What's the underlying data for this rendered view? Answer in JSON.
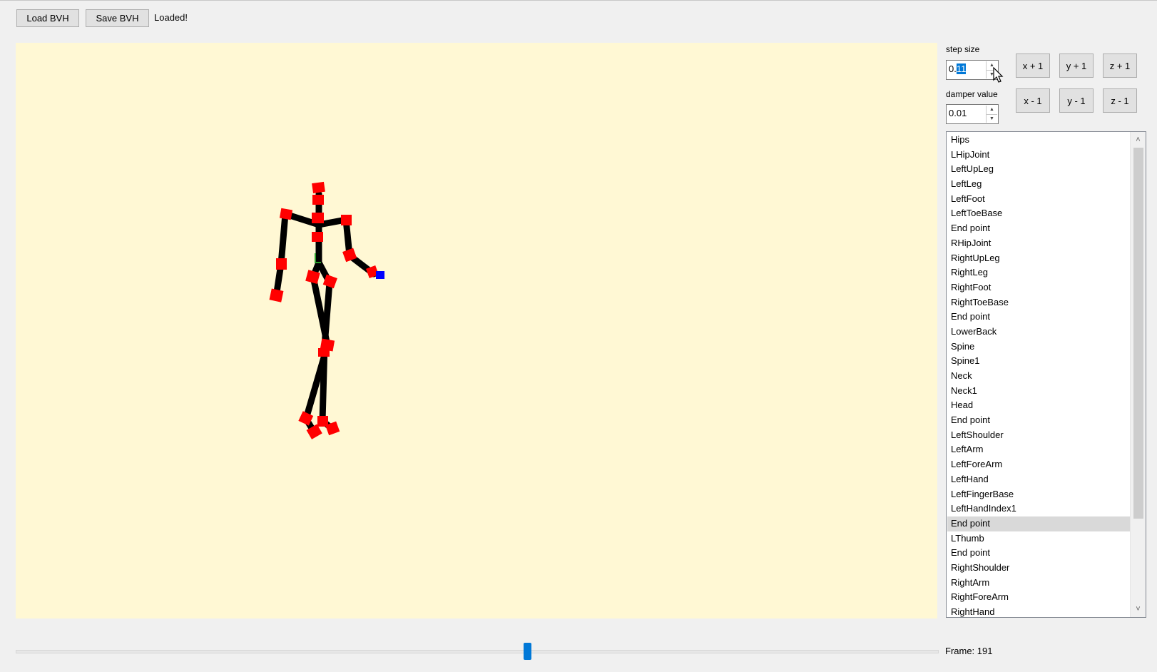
{
  "toolbar": {
    "load_label": "Load BVH",
    "save_label": "Save BVH",
    "status_text": "Loaded!"
  },
  "controls": {
    "step_size": {
      "label": "step size",
      "value_prefix": "0.",
      "value_selected": "11"
    },
    "damper": {
      "label": "damper value",
      "value": "0.01"
    },
    "spin_up": "▲",
    "spin_down": "▼",
    "buttons": {
      "x_plus": "x + 1",
      "y_plus": "y + 1",
      "z_plus": "z + 1",
      "x_minus": "x - 1",
      "y_minus": "y - 1",
      "z_minus": "z - 1"
    }
  },
  "joints": {
    "items": [
      "Hips",
      "LHipJoint",
      "LeftUpLeg",
      "LeftLeg",
      "LeftFoot",
      "LeftToeBase",
      "End point",
      "RHipJoint",
      "RightUpLeg",
      "RightLeg",
      "RightFoot",
      "RightToeBase",
      "End point",
      "LowerBack",
      "Spine",
      "Spine1",
      "Neck",
      "Neck1",
      "Head",
      "End point",
      "LeftShoulder",
      "LeftArm",
      "LeftForeArm",
      "LeftHand",
      "LeftFingerBase",
      "LeftHandIndex1",
      "End point",
      "LThumb",
      "End point",
      "RightShoulder",
      "RightArm",
      "RightForeArm",
      "RightHand"
    ],
    "selected_index": 26,
    "scroll_up": "˄",
    "scroll_down": "˅"
  },
  "timeline": {
    "frame_label": "Frame:",
    "frame_value": "191",
    "position": 0.555
  },
  "colors": {
    "viewport_bg": "#fff8d4",
    "bone": "#000000",
    "joint": "#ff0000",
    "selected_joint": "#0000ff",
    "accent": "#0078d7"
  }
}
